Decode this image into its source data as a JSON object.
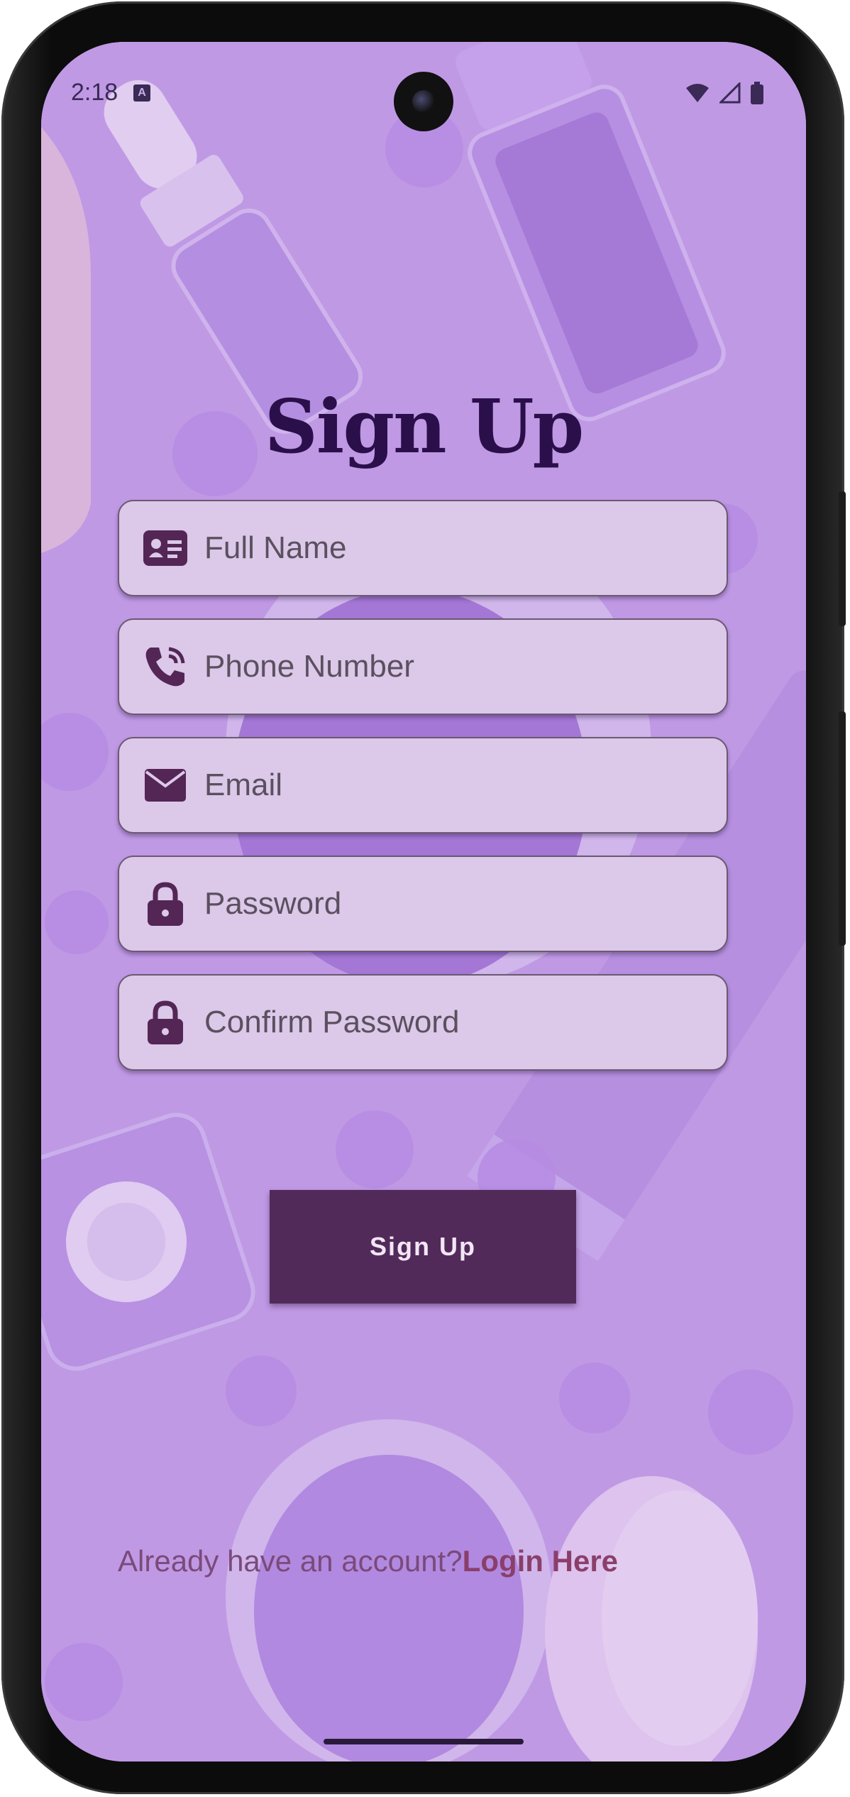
{
  "status_bar": {
    "time": "2:18",
    "notification_icon": "a-icon",
    "right_icons": [
      "wifi-icon",
      "signal-icon",
      "battery-icon"
    ]
  },
  "title": "Sign Up",
  "fields": [
    {
      "icon": "id-card-icon",
      "placeholder": "Full Name"
    },
    {
      "icon": "phone-icon",
      "placeholder": "Phone Number"
    },
    {
      "icon": "mail-icon",
      "placeholder": "Email"
    },
    {
      "icon": "lock-icon",
      "placeholder": "Password"
    },
    {
      "icon": "lock-icon",
      "placeholder": "Confirm Password"
    }
  ],
  "signup_button": "Sign Up",
  "login_prompt": {
    "text": "Already have an account?",
    "link": "Login Here"
  },
  "colors": {
    "title": "#2b0f4a",
    "field_bg": "#dcc8e8",
    "button_bg": "#522a5a",
    "link": "#8a3f6a"
  }
}
